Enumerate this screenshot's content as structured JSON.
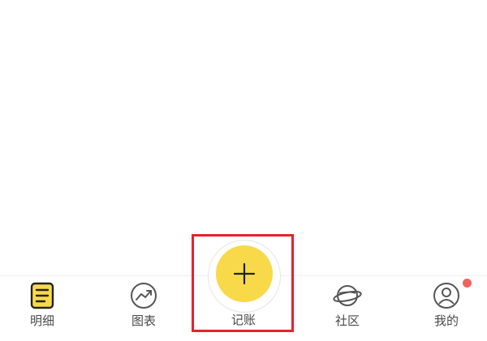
{
  "tabs": {
    "detail": {
      "label": "明细",
      "icon": "list-document-icon"
    },
    "chart": {
      "label": "图表",
      "icon": "trend-chart-icon"
    },
    "add": {
      "label": "记账",
      "icon": "plus-icon"
    },
    "community": {
      "label": "社区",
      "icon": "planet-icon"
    },
    "me": {
      "label": "我的",
      "icon": "user-icon",
      "has_notification": true
    }
  },
  "colors": {
    "accent_yellow": "#f8d94a",
    "highlight_red": "#e8212a",
    "badge_red": "#f0625a",
    "label_gray": "#4a4a4a"
  }
}
